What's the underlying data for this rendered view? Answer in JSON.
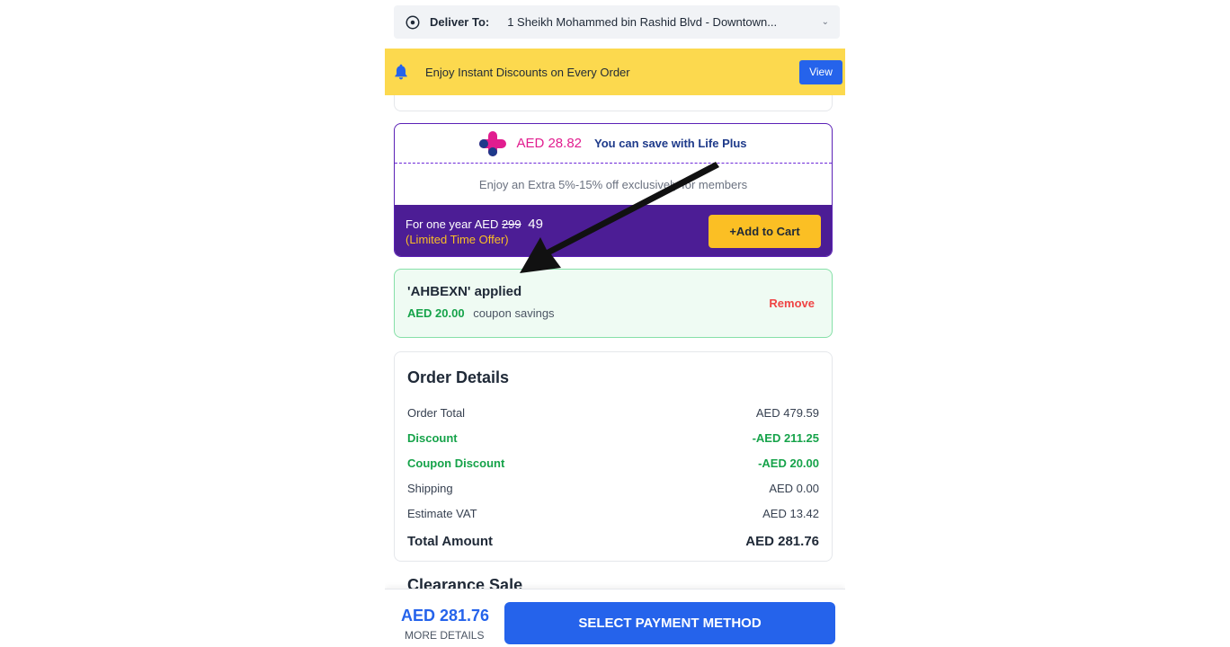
{
  "delivery": {
    "label": "Deliver To:",
    "address": "1 Sheikh Mohammed bin Rashid Blvd - Downtown..."
  },
  "promo_banner": {
    "text": "Enjoy Instant Discounts on Every Order",
    "view_label": "View"
  },
  "life_plus": {
    "amount": "AED 28.82",
    "save_text": "You can save with Life Plus",
    "member_text": "Enjoy an Extra 5%-15% off exclusively for members",
    "year_prefix": "For one year AED",
    "old_price": "299",
    "new_price": "49",
    "limited": "(Limited Time Offer)",
    "add_label": "+Add to Cart",
    "logo_colors": [
      "#e11d8f",
      "#1e3a8a"
    ]
  },
  "coupon": {
    "code_text": "'AHBEXN' applied",
    "savings_amount": "AED 20.00",
    "savings_label": "coupon savings",
    "remove_label": "Remove"
  },
  "order_details": {
    "title": "Order Details",
    "rows": [
      {
        "label": "Order Total",
        "value": "AED 479.59"
      },
      {
        "label": "Discount",
        "value": "-AED 211.25"
      },
      {
        "label": "Coupon Discount",
        "value": "-AED 20.00"
      },
      {
        "label": "Shipping",
        "value": "AED 0.00"
      },
      {
        "label": "Estimate VAT",
        "value": "AED 13.42"
      }
    ],
    "total_label": "Total Amount",
    "total_value": "AED 281.76"
  },
  "next_section_title": "Clearance Sale",
  "checkout": {
    "amount": "AED 281.76",
    "more_details": "MORE DETAILS",
    "pay_label": "SELECT PAYMENT METHOD"
  },
  "colors": {
    "brand_blue": "#2563eb",
    "promo_yellow": "#fcd94e",
    "life_plus_purple": "#4c1d95",
    "savings_green": "#16a34a",
    "remove_red": "#ef4444"
  }
}
